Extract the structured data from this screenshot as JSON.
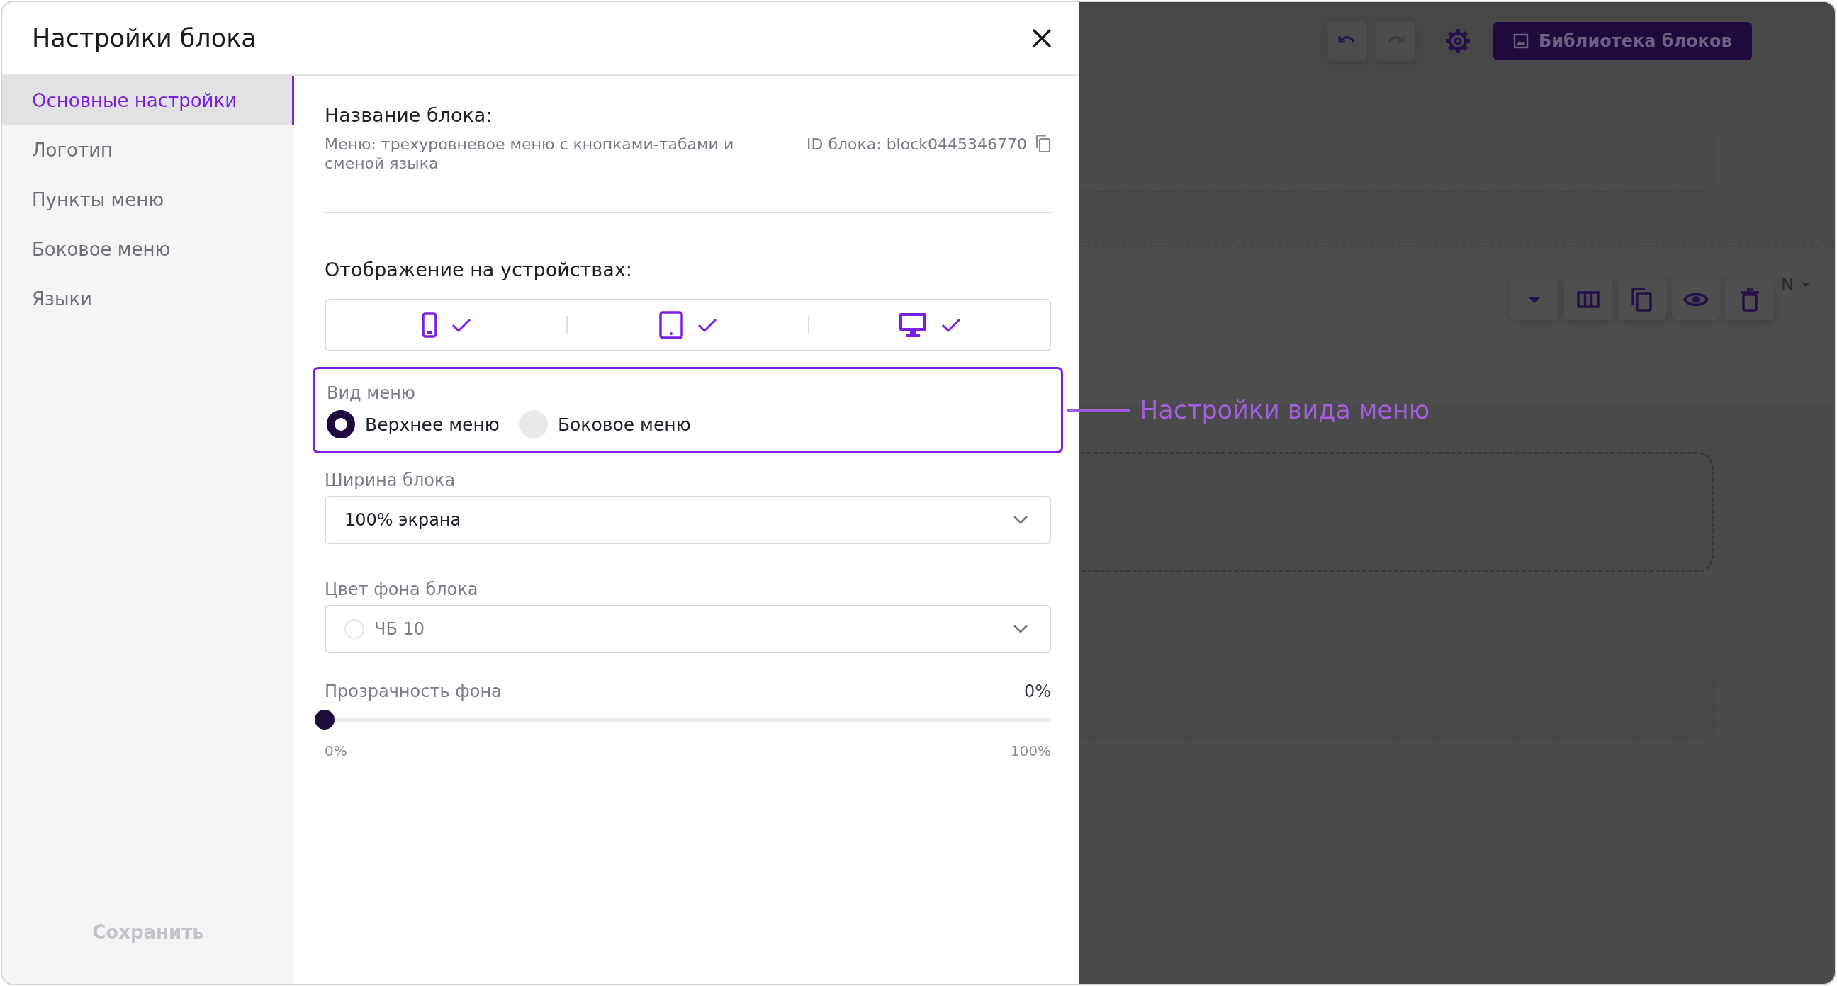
{
  "dialog": {
    "title": "Настройки блока"
  },
  "sidebar": {
    "items": [
      {
        "label": "Основные настройки",
        "selected": true
      },
      {
        "label": "Логотип",
        "selected": false
      },
      {
        "label": "Пункты меню",
        "selected": false
      },
      {
        "label": "Боковое меню",
        "selected": false
      },
      {
        "label": "Языки",
        "selected": false
      }
    ],
    "save_button": {
      "label": "Сохранить",
      "disabled": true
    }
  },
  "block_name": {
    "heading": "Название блока:",
    "description": "Меню: трехуровневое меню с кнопками-табами и сменой языка",
    "id_text": "ID блока: block0445346770"
  },
  "devices": {
    "heading": "Отображение на устройствах:",
    "items": [
      {
        "kind": "phone",
        "checked": true
      },
      {
        "kind": "tablet",
        "checked": true
      },
      {
        "kind": "desktop",
        "checked": true
      }
    ]
  },
  "menu_type": {
    "label": "Вид меню",
    "highlighted": true,
    "options": [
      {
        "label": "Верхнее меню",
        "selected": true
      },
      {
        "label": "Боковое меню",
        "selected": false
      }
    ]
  },
  "block_width": {
    "label": "Ширина блока",
    "value": "100% экрана"
  },
  "background_color": {
    "label": "Цвет фона блока",
    "value": "ЧБ 10"
  },
  "opacity": {
    "label": "Прозрачность фона",
    "reading": "0%",
    "level": 0,
    "min_label": "0%",
    "max_label": "100%"
  },
  "annotation": {
    "text": "Настройки вида меню"
  },
  "editor": {
    "library_button": "Библиотека блоков",
    "language_label": "N"
  }
}
